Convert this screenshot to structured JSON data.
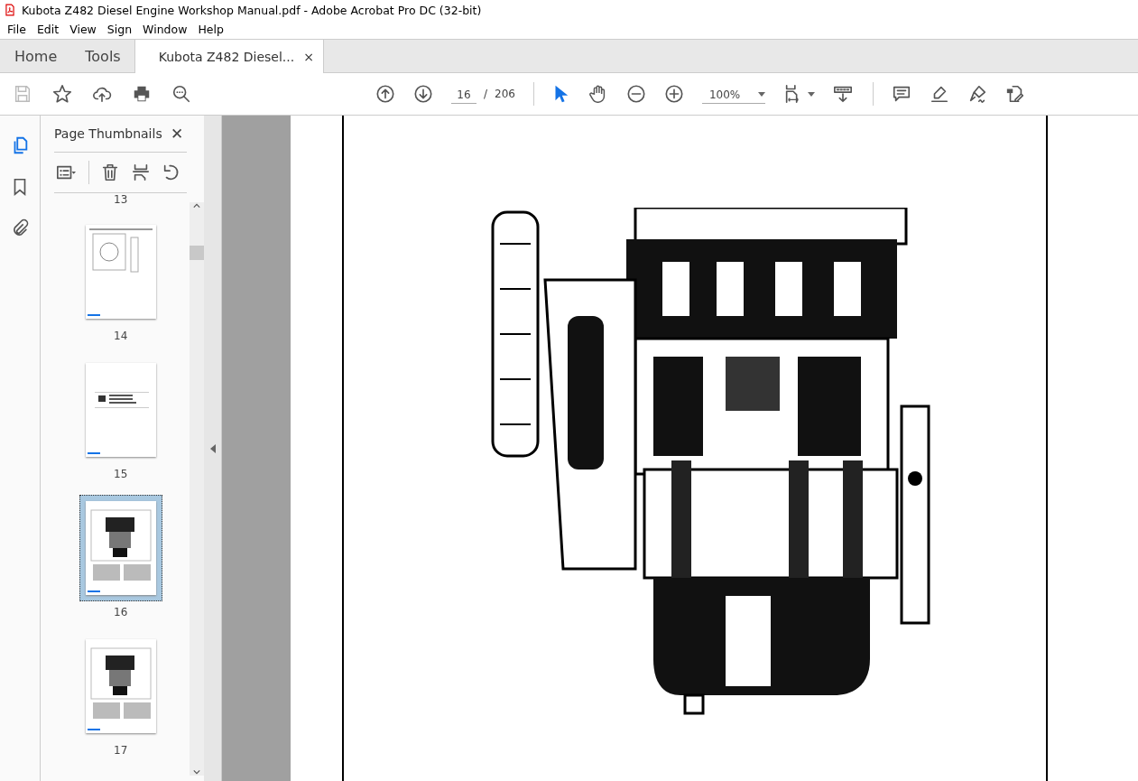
{
  "window": {
    "title": "Kubota Z482 Diesel Engine Workshop Manual.pdf - Adobe Acrobat Pro DC (32-bit)"
  },
  "menu": [
    "File",
    "Edit",
    "View",
    "Sign",
    "Window",
    "Help"
  ],
  "tabs": [
    {
      "label": "Home",
      "selected": false,
      "kind": "nav"
    },
    {
      "label": "Tools",
      "selected": false,
      "kind": "nav"
    },
    {
      "label": "Kubota Z482 Diesel...",
      "selected": true,
      "kind": "document",
      "close": "×"
    }
  ],
  "toolbar": {
    "page_number": "16",
    "page_separator": "/",
    "page_total": "206",
    "zoom": "100%",
    "tools": [
      {
        "kind": "select",
        "selected": true
      },
      {
        "kind": "hand",
        "selected": false
      }
    ]
  },
  "rail": [
    {
      "kind": "thumbnails",
      "selected": true
    },
    {
      "kind": "bookmarks",
      "selected": false
    },
    {
      "kind": "attachments",
      "selected": false
    }
  ],
  "sidebar": {
    "title": "Page Thumbnails",
    "close": "✕",
    "thumbnails": [
      {
        "label": "13",
        "selected": false,
        "kind": "hidden"
      },
      {
        "label": "14",
        "selected": false,
        "kind": "diagram"
      },
      {
        "label": "15",
        "selected": false,
        "kind": "section"
      },
      {
        "label": "16",
        "selected": true,
        "kind": "engine"
      },
      {
        "label": "17",
        "selected": false,
        "kind": "engine"
      }
    ]
  }
}
